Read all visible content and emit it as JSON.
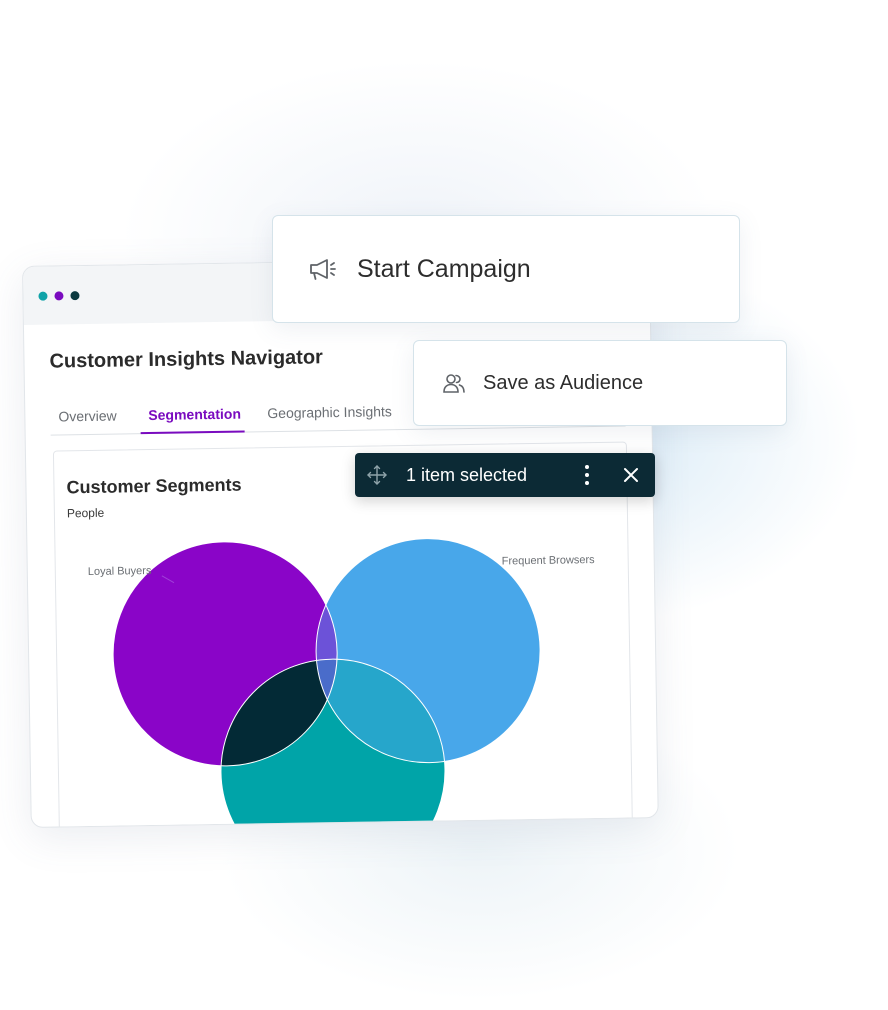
{
  "window": {
    "title": "Customer Insights Navigator",
    "dots": [
      "#10a3a8",
      "#7a0bbf",
      "#0c3a40"
    ]
  },
  "tabs": [
    {
      "label": "Overview",
      "active": false
    },
    {
      "label": "Segmentation",
      "active": true
    },
    {
      "label": "Geographic Insights",
      "active": false
    }
  ],
  "card": {
    "title": "Customer Segments",
    "subtitle": "People"
  },
  "chart_data": {
    "type": "venn",
    "sets": [
      {
        "name": "Loyal Buyers",
        "color": "#8a05c8"
      },
      {
        "name": "Frequent Browsers",
        "color": "#48a7ea"
      },
      {
        "name": "",
        "color": "#00a4a8"
      }
    ],
    "intersections": [
      {
        "sets": [
          "Loyal Buyers",
          "Frequent Browsers"
        ],
        "color": "#6c52d8"
      },
      {
        "sets": [
          "Loyal Buyers",
          "third"
        ],
        "color": "#032a36"
      },
      {
        "sets": [
          "Frequent Browsers",
          "third"
        ],
        "color": "#26a6cb"
      },
      {
        "sets": [
          "Loyal Buyers",
          "Frequent Browsers",
          "third"
        ],
        "color": "#4a6cca"
      }
    ]
  },
  "actions": {
    "start_campaign": {
      "label": "Start Campaign",
      "icon": "megaphone-icon"
    },
    "save_audience": {
      "label": "Save as Audience",
      "icon": "users-icon"
    }
  },
  "selection": {
    "label": "1 item selected",
    "move_icon": "move-icon",
    "more_icon": "more-vertical-icon",
    "close_icon": "close-icon"
  },
  "colors": {
    "accent": "#7a0bbf",
    "toolbar_bg": "#0c2a35"
  }
}
